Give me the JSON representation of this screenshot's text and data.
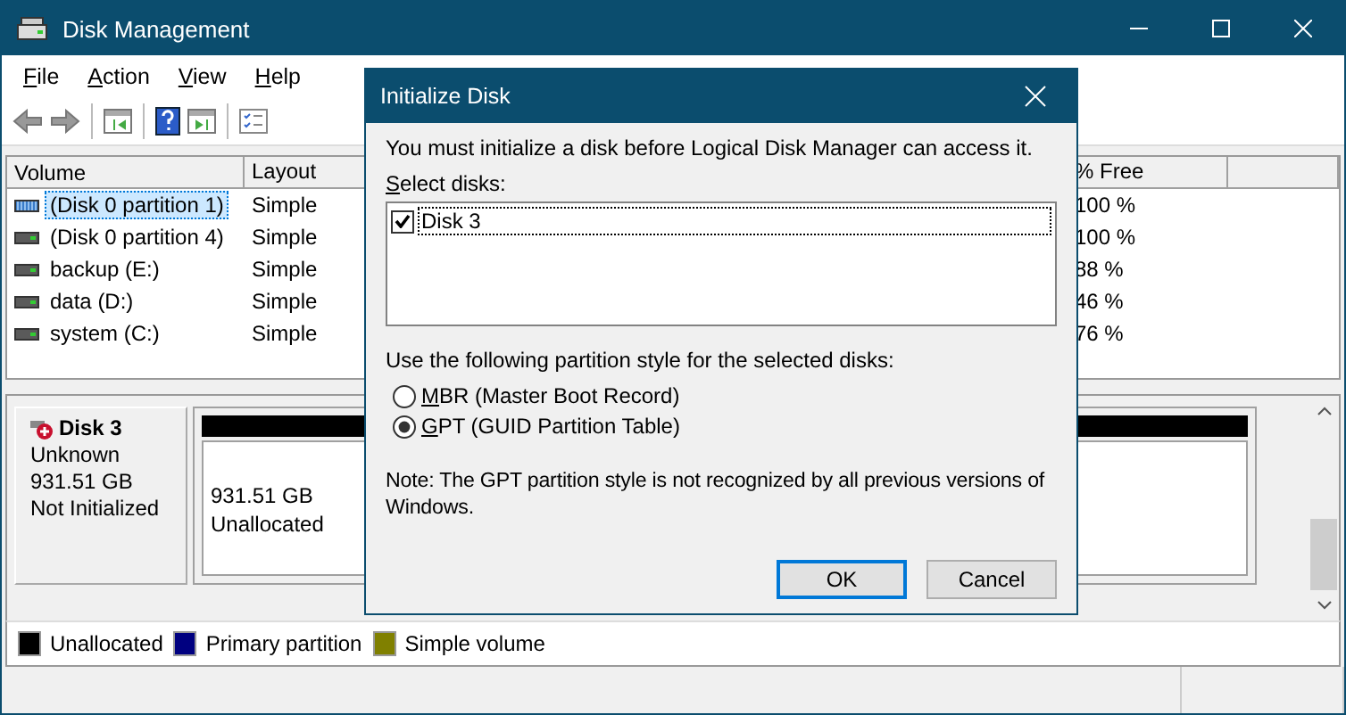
{
  "window": {
    "title": "Disk Management"
  },
  "menu": [
    "File",
    "Action",
    "View",
    "Help"
  ],
  "volumes": {
    "columns": [
      "Volume",
      "Layout",
      "% Free"
    ],
    "rows": [
      {
        "kind": "striped",
        "volume": "(Disk 0 partition 1)",
        "layout": "Simple",
        "free": "100 %",
        "selected": true
      },
      {
        "kind": "plain",
        "volume": "(Disk 0 partition 4)",
        "layout": "Simple",
        "free": "100 %",
        "selected": false
      },
      {
        "kind": "plain",
        "volume": "backup (E:)",
        "layout": "Simple",
        "free": "88 %",
        "selected": false
      },
      {
        "kind": "plain",
        "volume": "data (D:)",
        "layout": "Simple",
        "free": "46 %",
        "selected": false
      },
      {
        "kind": "plain",
        "volume": "system (C:)",
        "layout": "Simple",
        "free": "76 %",
        "selected": false
      }
    ]
  },
  "disk": {
    "name": "Disk 3",
    "type": "Unknown",
    "size": "931.51 GB",
    "status": "Not Initialized",
    "partition": {
      "size": "931.51 GB",
      "label": "Unallocated",
      "color": "#000000"
    }
  },
  "legend": [
    {
      "label": "Unallocated",
      "color": "#000000"
    },
    {
      "label": "Primary partition",
      "color": "#000080"
    },
    {
      "label": "Simple volume",
      "color": "#808000"
    }
  ],
  "dialog": {
    "title": "Initialize Disk",
    "message": "You must initialize a disk before Logical Disk Manager can access it.",
    "select_label": "Select disks:",
    "disks": [
      {
        "label": "Disk 3",
        "checked": true
      }
    ],
    "style_label": "Use the following partition style for the selected disks:",
    "styles": [
      {
        "label": "MBR (Master Boot Record)",
        "selected": false
      },
      {
        "label": "GPT (GUID Partition Table)",
        "selected": true
      }
    ],
    "note": "Note: The GPT partition style is not recognized by all previous versions of Windows.",
    "buttons": [
      {
        "label": "OK",
        "default": true
      },
      {
        "label": "Cancel",
        "default": false
      }
    ]
  }
}
